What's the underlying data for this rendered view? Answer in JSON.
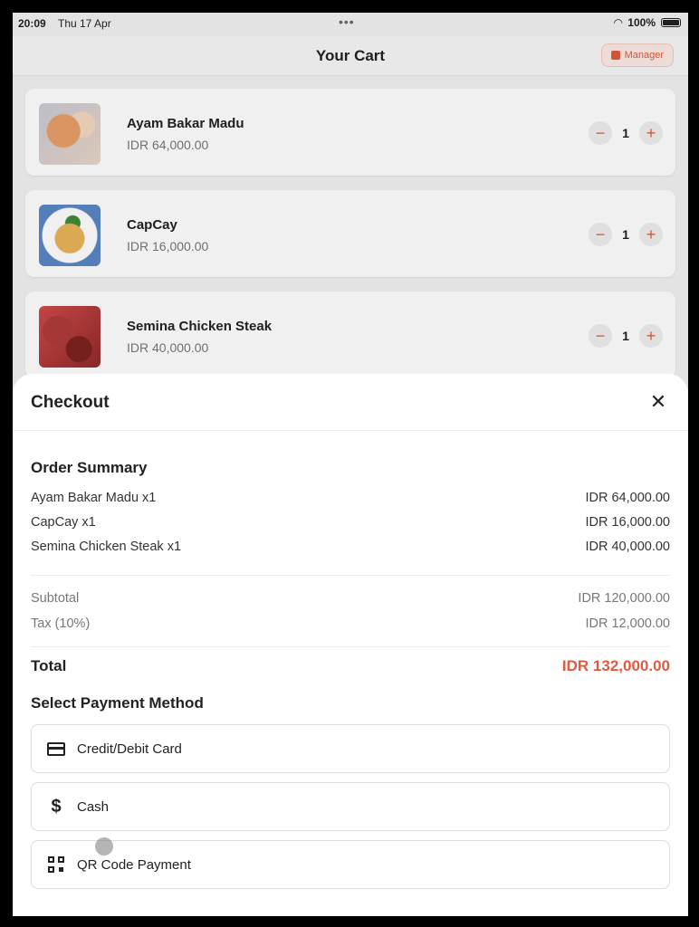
{
  "status_bar": {
    "time": "20:09",
    "date": "Thu 17 Apr",
    "battery": "100%"
  },
  "header": {
    "title": "Your Cart",
    "manager_label": "Manager"
  },
  "cart_items": [
    {
      "name": "Ayam Bakar Madu",
      "price": "IDR 64,000.00",
      "qty": "1"
    },
    {
      "name": "CapCay",
      "price": "IDR 16,000.00",
      "qty": "1"
    },
    {
      "name": "Semina Chicken Steak",
      "price": "IDR 40,000.00",
      "qty": "1"
    }
  ],
  "qty_controls": {
    "minus": "−",
    "plus": "+"
  },
  "checkout": {
    "title": "Checkout",
    "close": "✕",
    "order_summary_title": "Order Summary",
    "lines": [
      {
        "label": "Ayam Bakar Madu x1",
        "amount": "IDR 64,000.00"
      },
      {
        "label": "CapCay x1",
        "amount": "IDR 16,000.00"
      },
      {
        "label": "Semina Chicken Steak x1",
        "amount": "IDR 40,000.00"
      }
    ],
    "subtotal_label": "Subtotal",
    "subtotal": "IDR 120,000.00",
    "tax_label": "Tax (10%)",
    "tax": "IDR 12,000.00",
    "total_label": "Total",
    "total": "IDR 132,000.00",
    "payment_title": "Select Payment Method",
    "payment_methods": [
      {
        "label": "Credit/Debit Card",
        "icon": "credit-card-icon"
      },
      {
        "label": "Cash",
        "icon": "dollar-icon"
      },
      {
        "label": "QR Code Payment",
        "icon": "qr-code-icon"
      }
    ]
  },
  "colors": {
    "accent": "#e05a3f"
  }
}
